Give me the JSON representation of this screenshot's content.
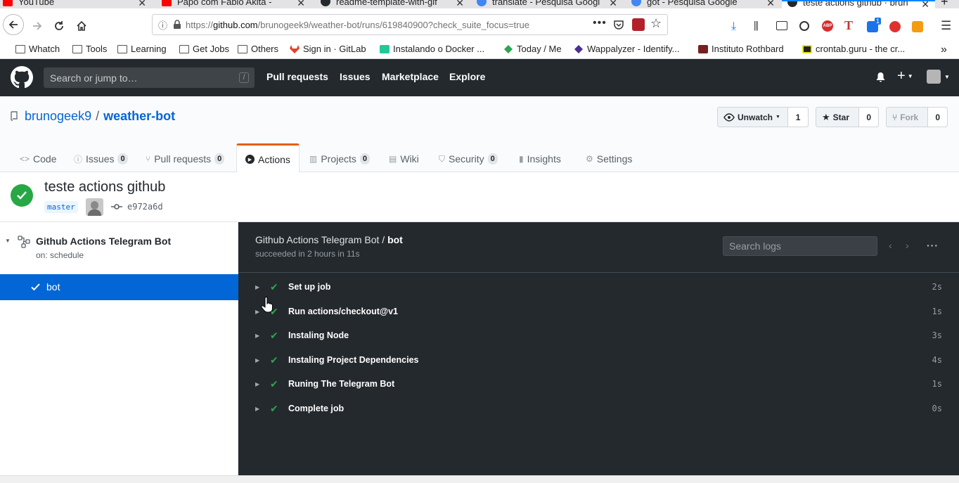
{
  "browser": {
    "tabs": [
      {
        "title": "YouTube",
        "favicon_color": "#ff0000"
      },
      {
        "title": "Papo com Fabio Akita -",
        "favicon_color": "#ff0000"
      },
      {
        "title": "readme-template-with-gif",
        "favicon_color": "#24292e"
      },
      {
        "title": "translate - Pesquisa Googl",
        "favicon_color": "#4285f4"
      },
      {
        "title": "got - Pesquisa Google",
        "favicon_color": "#4285f4"
      },
      {
        "title": "teste actions github · brun",
        "favicon_color": "#24292e"
      }
    ],
    "url_prefix": "https://",
    "url_host": "github.com",
    "url_path": "/brunogeek9/weather-bot/runs/619840900?check_suite_focus=true",
    "ublock_badge": "1",
    "bookmarks": [
      {
        "label": "Whatch",
        "icon": "folder-icon"
      },
      {
        "label": "Tools",
        "icon": "folder-icon"
      },
      {
        "label": "Learning",
        "icon": "folder-icon"
      },
      {
        "label": "Get Jobs",
        "icon": "folder-icon"
      },
      {
        "label": "Others",
        "icon": "folder-icon"
      },
      {
        "label": "Sign in · GitLab",
        "icon": "gitlab-icon"
      },
      {
        "label": "Instalando o Docker ...",
        "icon": "docker-icon"
      },
      {
        "label": "Today / Me",
        "icon": "diamond-icon"
      },
      {
        "label": "Wappalyzer - Identify...",
        "icon": "wappalyzer-icon"
      },
      {
        "label": "Instituto Rothbard",
        "icon": "shield-icon"
      },
      {
        "label": "crontab.guru - the cr...",
        "icon": "crontab-icon"
      }
    ]
  },
  "github": {
    "search_placeholder": "Search or jump to…",
    "search_shortcut": "/",
    "nav": [
      "Pull requests",
      "Issues",
      "Marketplace",
      "Explore"
    ]
  },
  "repo": {
    "owner": "brunogeek9",
    "separator": "/",
    "name": "weather-bot",
    "unwatch_label": "Unwatch",
    "watch_count": "1",
    "star_label": "Star",
    "star_count": "0",
    "fork_label": "Fork",
    "fork_count": "0",
    "tabs": [
      {
        "label": "Code",
        "count": null,
        "icon": "<>"
      },
      {
        "label": "Issues",
        "count": "0",
        "icon": "ⓘ"
      },
      {
        "label": "Pull requests",
        "count": "0",
        "icon": "⑂"
      },
      {
        "label": "Actions",
        "count": null,
        "icon": "▶",
        "selected": true
      },
      {
        "label": "Projects",
        "count": "0",
        "icon": "▥"
      },
      {
        "label": "Wiki",
        "count": null,
        "icon": "▤"
      },
      {
        "label": "Security",
        "count": "0",
        "icon": "⛉"
      },
      {
        "label": "Insights",
        "count": null,
        "icon": "▮"
      },
      {
        "label": "Settings",
        "count": null,
        "icon": "⚙"
      }
    ]
  },
  "run": {
    "title": "teste actions github",
    "branch": "master",
    "commit": "e972a6d"
  },
  "sidebar": {
    "workflow_name": "Github Actions Telegram Bot",
    "trigger": "on: schedule",
    "job": "bot"
  },
  "log": {
    "workflow": "Github Actions Telegram Bot",
    "separator": " / ",
    "job": "bot",
    "summary": "succeeded in 2 hours in 11s",
    "search_placeholder": "Search logs",
    "steps": [
      {
        "name": "Set up job",
        "time": "2s"
      },
      {
        "name": "Run actions/checkout@v1",
        "time": "1s"
      },
      {
        "name": "Instaling Node",
        "time": "3s"
      },
      {
        "name": "Instaling Project Dependencies",
        "time": "4s"
      },
      {
        "name": "Runing The Telegram Bot",
        "time": "1s"
      },
      {
        "name": "Complete job",
        "time": "0s"
      }
    ]
  },
  "colors": {
    "success": "#28a745",
    "selected_job": "#0366d6",
    "header_bg": "#24292e",
    "link": "#0366d6",
    "active_tab_accent": "#e36209"
  }
}
